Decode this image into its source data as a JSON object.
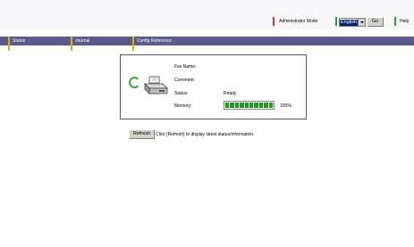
{
  "header": {
    "admin_mode_label": "Administrator Mode",
    "language_value": "English",
    "go_label": "Go",
    "help_label": "Help"
  },
  "nav": {
    "tabs": [
      {
        "label": "Status"
      },
      {
        "label": "Journal"
      },
      {
        "label": "Config Reference"
      }
    ]
  },
  "status": {
    "fax_name_label": "Fax Name:",
    "comment_label": "Comment:",
    "status_label": "Status:",
    "status_value": "Ready",
    "memory_label": "Memory:",
    "memory_percent": 100,
    "memory_text": "100%"
  },
  "refresh": {
    "button_label": "Refresh",
    "hint": "Click [Refresh] to display latest status/information."
  },
  "colors": {
    "nav_bg": "#5a5a8c",
    "tab_marker": "#e0b000",
    "admin_marker": "#d83a16",
    "green_accent": "#22a52a",
    "memory_fill": "#1b9a1b"
  },
  "icons": {
    "device": "fax-machine-icon",
    "activity": "refresh-cycle-icon",
    "dropdown": "chevron-down-icon"
  }
}
